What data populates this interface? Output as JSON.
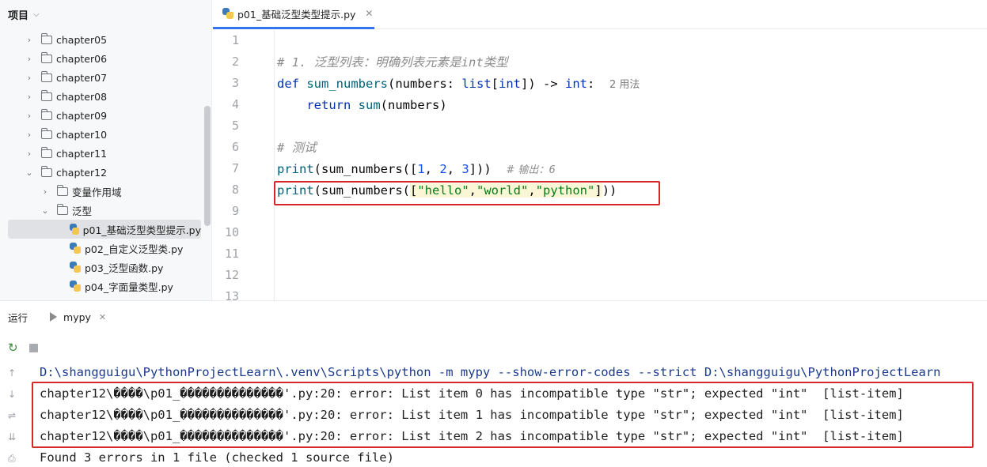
{
  "sidebar": {
    "title": "项目",
    "items": [
      {
        "label": "chapter05",
        "type": "folder",
        "expanded": false,
        "depth": 0
      },
      {
        "label": "chapter06",
        "type": "folder",
        "expanded": false,
        "depth": 0
      },
      {
        "label": "chapter07",
        "type": "folder",
        "expanded": false,
        "depth": 0
      },
      {
        "label": "chapter08",
        "type": "folder",
        "expanded": false,
        "depth": 0
      },
      {
        "label": "chapter09",
        "type": "folder",
        "expanded": false,
        "depth": 0
      },
      {
        "label": "chapter10",
        "type": "folder",
        "expanded": false,
        "depth": 0
      },
      {
        "label": "chapter11",
        "type": "folder",
        "expanded": false,
        "depth": 0
      },
      {
        "label": "chapter12",
        "type": "folder",
        "expanded": true,
        "depth": 0
      },
      {
        "label": "变量作用域",
        "type": "folder",
        "expanded": false,
        "depth": 1
      },
      {
        "label": "泛型",
        "type": "folder",
        "expanded": true,
        "depth": 1
      },
      {
        "label": "p01_基础泛型类型提示.py",
        "type": "python-file",
        "selected": true,
        "depth": 2
      },
      {
        "label": "p02_自定义泛型类.py",
        "type": "python-file",
        "depth": 2
      },
      {
        "label": "p03_泛型函数.py",
        "type": "python-file",
        "depth": 2
      },
      {
        "label": "p04_字面量类型.py",
        "type": "python-file",
        "depth": 2
      }
    ]
  },
  "editor": {
    "tab_label": "p01_基础泛型类型提示.py",
    "line_numbers": [
      "1",
      "2",
      "3",
      "4",
      "5",
      "6",
      "7",
      "8",
      "9",
      "10",
      "11",
      "12",
      "13"
    ],
    "line2_comment": "# 1. 泛型列表：明确列表元素是int类型",
    "line3": {
      "kw": "def",
      "fn": "sum_numbers",
      "p1": "(numbers: ",
      "t1": "list",
      "p2": "[",
      "t2": "int",
      "p3": "]) -> ",
      "t3": "int",
      "p4": ":",
      "usage_hint": "2 用法"
    },
    "line4": {
      "kw": "return",
      "fn": "sum",
      "rest": "(numbers)"
    },
    "line6_comment": "# 测试",
    "line7": {
      "fn": "print",
      "p1": "(sum_numbers([",
      "n1": "1",
      "c1": ", ",
      "n2": "2",
      "c2": ", ",
      "n3": "3",
      "p2": "]))",
      "comment": "# 输出：6"
    },
    "line8": {
      "fn": "print",
      "p1": "(sum_numbers(",
      "lb": "[",
      "s1": "\"hello\"",
      "c1": ",",
      "s2": "\"world\"",
      "c2": ",",
      "s3": "\"python\"",
      "rb": "]",
      "p2": "))"
    }
  },
  "run_panel": {
    "title": "运行",
    "tab_label": "mypy",
    "console_lines": [
      "D:\\shangguigu\\PythonProjectLearn\\.venv\\Scripts\\python -m mypy --show-error-codes --strict D:\\shangguigu\\PythonProjectLearn",
      "chapter12\\����\\p01_��������������'.py:20: error: List item 0 has incompatible type \"str\"; expected \"int\"  [list-item]",
      "chapter12\\����\\p01_��������������'.py:20: error: List item 1 has incompatible type \"str\"; expected \"int\"  [list-item]",
      "chapter12\\����\\p01_��������������'.py:20: error: List item 2 has incompatible type \"str\"; expected \"int\"  [list-item]",
      "Found 3 errors in 1 file (checked 1 source file)"
    ]
  },
  "colors": {
    "keyword": "#0033b3",
    "function": "#00627a",
    "string": "#067d17",
    "number": "#1750eb",
    "comment": "#8c8c8c",
    "highlight_box": "#d9262c",
    "tab_underline": "#3574f0"
  }
}
